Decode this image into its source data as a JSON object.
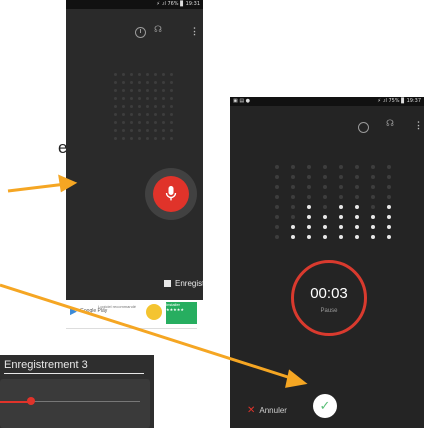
{
  "fragment_left_letter": "e",
  "phone_main": {
    "status_bar": "⚡ .ıl 76% ▊ 19:31",
    "format_icon_text": "☊",
    "menu_icon_text": "⋮",
    "recordings_label": "Enregistrements",
    "ad": {
      "store_label": "Google Play",
      "description": "Logiciel recommandé",
      "promo_text": "Installer ★★★★★"
    }
  },
  "phone_recording": {
    "status_left": "▣ ▤ ●",
    "status_right": "⚡ .ıl 75% ▊ 19:37",
    "format_icon_text": "☊",
    "menu_icon_text": "⋮",
    "timer": "00:03",
    "state": "Pause",
    "cancel_label": "Annuler",
    "confirm_icon": "✓",
    "waveform_levels": [
      0.0,
      0.35,
      0.5,
      0.4,
      0.5,
      0.55,
      0.4,
      0.5
    ]
  },
  "recording_detail": {
    "title": "Enregistrement 3",
    "progress": 0.22
  },
  "colors": {
    "accent_red": "#e0332a",
    "arrow_orange": "#f5a623",
    "confirm_green": "#5bbf78",
    "panel_dark": "#242424"
  }
}
